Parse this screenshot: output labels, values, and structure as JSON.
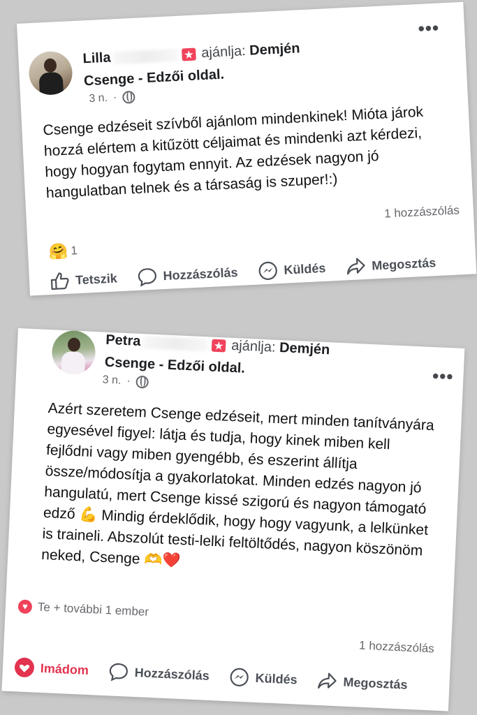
{
  "posts": [
    {
      "author": "Lilla",
      "recommends_text": "ajánlja:",
      "page_name_part1": "Demjén",
      "page_name_part2": "Csenge - Edzői oldal",
      "time": "3 n.",
      "body": "Csenge edzéseit szívből ajánlom mindenkinek! Mióta járok hozzá elértem a kitűzött céljaimat és mindenki azt kérdezi, hogy hogyan fogytam ennyit. Az edzések nagyon jó hangulatban telnek és a társaság is szuper!:)",
      "reaction_emoji": "🤗",
      "reaction_count": "1",
      "comment_count": "1 hozzászólás",
      "actions": {
        "like": "Tetszik",
        "comment": "Hozzászólás",
        "send": "Küldés",
        "share": "Megosztás"
      }
    },
    {
      "author": "Petra",
      "recommends_text": "ajánlja:",
      "page_name_part1": "Demjén",
      "page_name_part2": "Csenge - Edzői oldal",
      "time": "3 n.",
      "body": "Azért szeretem Csenge edzéseit, mert minden tanítványára egyesével figyel: látja és tudja, hogy kinek miben kell fejlődni vagy miben gyengébb, és eszerint állítja össze/módosítja a gyakorlatokat. Minden edzés nagyon jó hangulatú, mert Csenge kissé szigorú és nagyon támogató edző 💪 Mindig érdeklődik, hogy hogy vagyunk, a lelkünket is traineli. Abszolút testi-lelki feltöltődés, nagyon köszönöm neked, Csenge 🫶❤️",
      "reaction_text": "Te + további 1 ember",
      "comment_count": "1 hozzászólás",
      "actions": {
        "love": "Imádom",
        "comment": "Hozzászólás",
        "send": "Küldés",
        "share": "Megosztás"
      }
    }
  ],
  "colors": {
    "love": "#e2334f",
    "recommend_icon": "#f0435b",
    "secondary_text": "#65676b"
  },
  "icons": [
    "more-options-icon",
    "globe-icon",
    "recommend-icon",
    "like-icon",
    "comment-icon",
    "messenger-icon",
    "share-icon",
    "heart-icon"
  ]
}
